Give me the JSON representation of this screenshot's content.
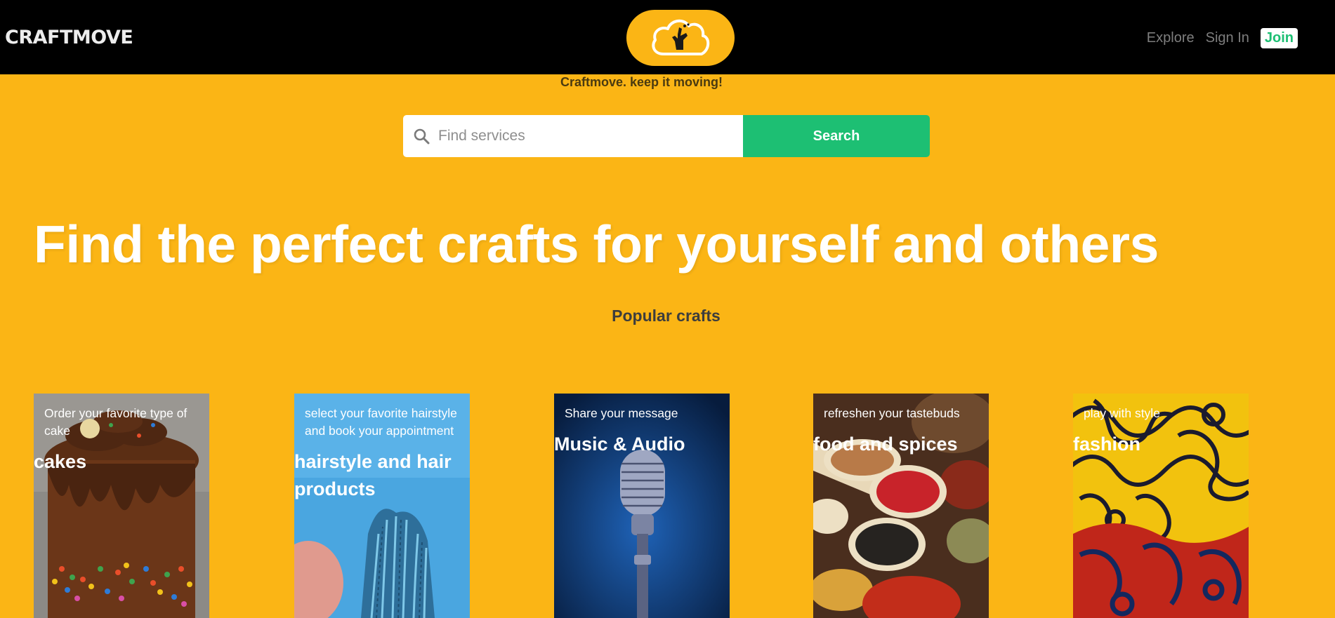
{
  "header": {
    "brand": "CRAFTMOVE",
    "nav": {
      "explore": "Explore",
      "sign_in": "Sign In",
      "join": "Join"
    }
  },
  "tagline": "Craftmove. keep it moving!",
  "search": {
    "placeholder": "Find services",
    "button_label": "Search"
  },
  "hero_title": "Find the perfect crafts for yourself and others",
  "popular": {
    "heading": "Popular crafts",
    "cards": [
      {
        "description": "Order your favorite type of cake",
        "title": "cakes"
      },
      {
        "description": "select your favorite hairstyle and book your appointment",
        "title": "hairstyle and hair products"
      },
      {
        "description": "Share your message",
        "title": "Music & Audio"
      },
      {
        "description": "refreshen your tastebuds",
        "title": "food and spices"
      },
      {
        "description": "play with style",
        "title": "fashion"
      }
    ]
  },
  "colors": {
    "background": "#FBB515",
    "header": "#000000",
    "accent_green": "#1DBF73"
  }
}
